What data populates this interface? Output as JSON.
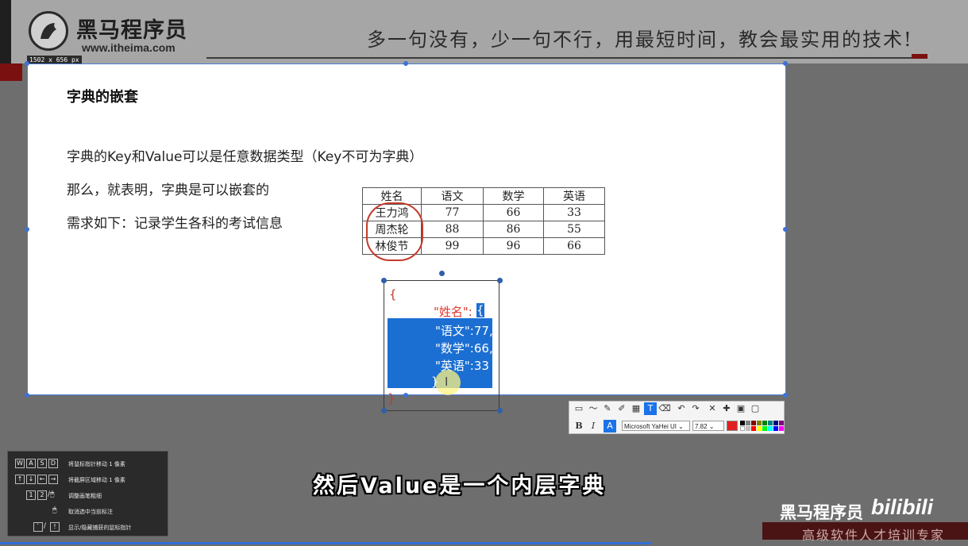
{
  "header": {
    "logo_cn": "黑马程序员",
    "logo_url": "www.itheima.com",
    "dimension_badge": "1502 x 656  px",
    "slogan": "多一句没有，少一句不行，用最短时间，教会最实用的技术!"
  },
  "slide": {
    "title": "字典的嵌套",
    "lines": [
      "字典的Key和Value可以是任意数据类型（Key不可为字典）",
      "那么，就表明，字典是可以嵌套的",
      "需求如下：记录学生各科的考试信息"
    ],
    "table": {
      "headers": [
        "姓名",
        "语文",
        "数学",
        "英语"
      ],
      "rows": [
        [
          "王力鸿",
          "77",
          "66",
          "33"
        ],
        [
          "周杰轮",
          "88",
          "86",
          "55"
        ],
        [
          "林俊节",
          "99",
          "96",
          "66"
        ]
      ]
    }
  },
  "annotation": {
    "open_brace": "{",
    "key_line": "\"姓名\":",
    "key_brace": "{",
    "sel_lines": [
      "\"语文\":77,",
      "\"数学\":66,",
      "\"英语\":33"
    ],
    "inner_close": "}",
    "outer_close": "}",
    "cursor_glyph": "I"
  },
  "toolbar": {
    "bold": "B",
    "italic": "I",
    "color_text": "A",
    "font_name": "Microsoft YaHei UI",
    "font_size": "7.82",
    "current_color": "#e02020"
  },
  "help": {
    "items": [
      {
        "keys": [
          "W",
          "A",
          "S",
          "D"
        ],
        "text": "将鼠标指针移动 1 像素"
      },
      {
        "keys": [
          "↑",
          "↓",
          "←",
          "→"
        ],
        "text": "将截屏区域移动 1 像素"
      },
      {
        "keys": [
          "1",
          "2"
        ],
        "text": "调整画笔粗细"
      },
      {
        "keys": [],
        "text": "取消选中当前标注"
      },
      {
        "keys": [
          "`",
          "!"
        ],
        "text": "显示/隐藏捕获的鼠标指针"
      }
    ]
  },
  "subtitle": "然后Value是一个内层字典",
  "brand": {
    "cn": "黑马程序员",
    "bili": "bilibili",
    "tagline": "高级软件人才培训专家"
  }
}
